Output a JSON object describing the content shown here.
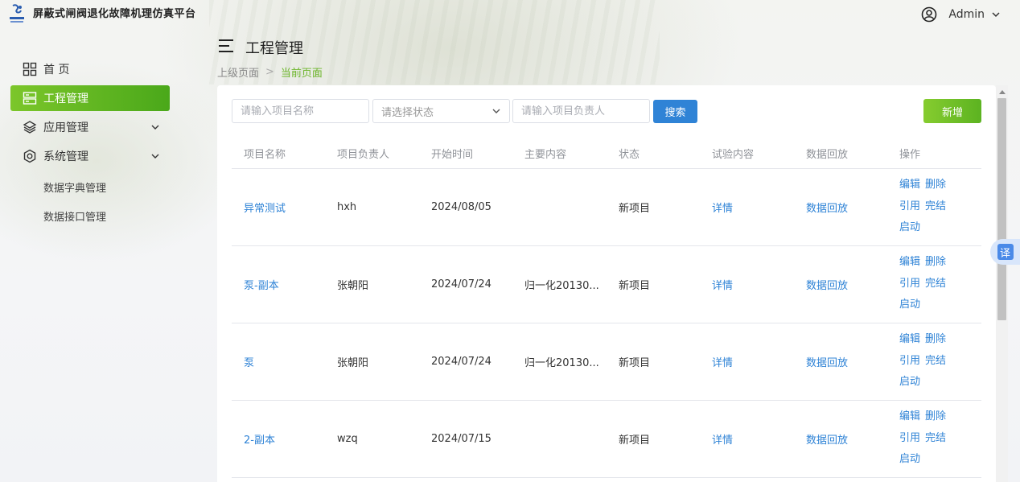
{
  "app": {
    "title": "屏蔽式闸阀退化故障机理仿真平台"
  },
  "user": {
    "name": "Admin"
  },
  "sidebar": {
    "items": [
      {
        "label": "首 页"
      },
      {
        "label": "工程管理"
      },
      {
        "label": "应用管理"
      },
      {
        "label": "系统管理"
      }
    ],
    "sub_items": [
      {
        "label": "数据字典管理"
      },
      {
        "label": "数据接口管理"
      }
    ]
  },
  "page": {
    "title": "工程管理",
    "breadcrumb": {
      "parent": "上级页面",
      "separator": ">",
      "current": "当前页面"
    }
  },
  "filters": {
    "name_placeholder": "请输入项目名称",
    "status_placeholder": "请选择状态",
    "owner_placeholder": "请输入项目负责人",
    "search_label": "搜索",
    "add_label": "新增"
  },
  "table": {
    "headers": [
      "项目名称",
      "项目负责人",
      "开始时间",
      "主要内容",
      "状态",
      "试验内容",
      "数据回放",
      "操作"
    ],
    "rows": [
      {
        "name": "异常测试",
        "owner": "hxh",
        "start": "2024/08/05",
        "content": "",
        "status": "新项目",
        "test": "详情",
        "playback": "数据回放"
      },
      {
        "name": "泵-副本",
        "owner": "张朝阳",
        "start": "2024/07/24",
        "content": "归一化20130...",
        "status": "新项目",
        "test": "详情",
        "playback": "数据回放"
      },
      {
        "name": "泵",
        "owner": "张朝阳",
        "start": "2024/07/24",
        "content": "归一化20130...",
        "status": "新项目",
        "test": "详情",
        "playback": "数据回放"
      },
      {
        "name": "2-副本",
        "owner": "wzq",
        "start": "2024/07/15",
        "content": "",
        "status": "新项目",
        "test": "详情",
        "playback": "数据回放"
      }
    ],
    "ops": {
      "edit": "编辑",
      "delete": "删除",
      "cite": "引用",
      "finish": "完结",
      "start": "启动"
    }
  },
  "translate": {
    "label": "译"
  },
  "colors": {
    "accent": "#6cb52a",
    "link": "#2f83d6"
  }
}
